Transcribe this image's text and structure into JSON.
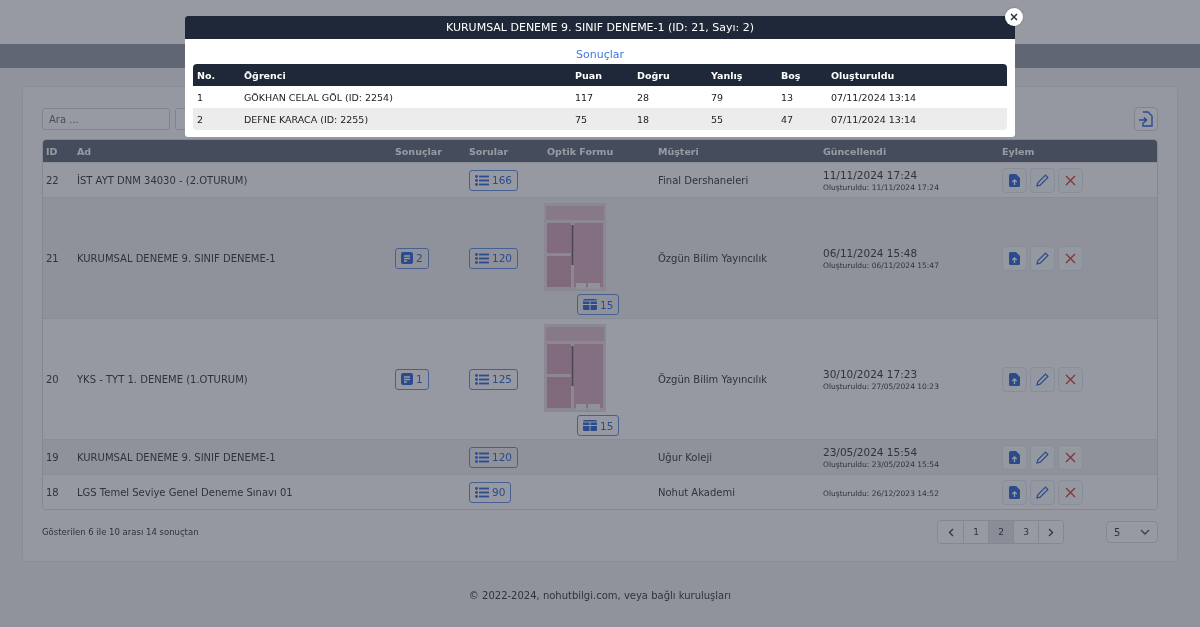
{
  "page": {
    "search": {
      "placeholder": "Ara ..."
    },
    "table": {
      "columns": [
        "ID",
        "Ad",
        "Sonuçlar",
        "Sorular",
        "Optik Formu",
        "Müşteri",
        "Güncellendi",
        "Eylem"
      ],
      "rows": [
        {
          "id": "22",
          "name": "İST AYT DNM 34030 - (2.OTURUM)",
          "results": null,
          "questions": "166",
          "optic": null,
          "customer": "Final Dershaneleri",
          "updated": "11/11/2024 17:24",
          "created": "Oluşturuldu: 11/11/2024 17:24"
        },
        {
          "id": "21",
          "name": "KURUMSAL DENEME 9. SINIF DENEME-1",
          "results": "2",
          "questions": "120",
          "optic": {
            "kind": "picture",
            "count": "15"
          },
          "customer": "Özgün Bilim Yayıncılık",
          "updated": "06/11/2024 15:48",
          "created": "Oluşturuldu: 06/11/2024 15:47"
        },
        {
          "id": "20",
          "name": "YKS - TYT 1. DENEME (1.OTURUM)",
          "results": "1",
          "questions": "125",
          "optic": {
            "kind": "picture",
            "count": "15"
          },
          "customer": "Özgün Bilim Yayıncılık",
          "updated": "30/10/2024 17:23",
          "created": "Oluşturuldu: 27/05/2024 10:23"
        },
        {
          "id": "19",
          "name": "KURUMSAL DENEME 9. SINIF DENEME-1",
          "results": null,
          "questions": "120",
          "optic": null,
          "customer": "Uğur Koleji",
          "updated": "23/05/2024 15:54",
          "created": "Oluşturuldu: 23/05/2024 15:54"
        },
        {
          "id": "18",
          "name": "LGS Temel Seviye Genel Deneme Sınavı 01",
          "results": null,
          "questions": "90",
          "optic": null,
          "customer": "Nohut Akademi",
          "updated": null,
          "created": "Oluşturuldu: 26/12/2023 14:52"
        }
      ]
    },
    "summary": "Gösterilen 6 ile 10 arası 14 sonuçtan",
    "pagination": {
      "pages": [
        {
          "label": "1",
          "selected": false
        },
        {
          "label": "2",
          "selected": true
        },
        {
          "label": "3",
          "selected": false
        }
      ]
    },
    "per_page": "5",
    "footer": "© 2022-2024, nohutbilgi.com, veya bağlı kuruluşları"
  },
  "modal": {
    "title": "KURUMSAL DENEME 9. SINIF DENEME-1 (ID: 21, Sayı: 2)",
    "section": "Sonuçlar",
    "columns": [
      "No.",
      "Öğrenci",
      "Puan",
      "Doğru",
      "Yanlış",
      "Boş",
      "Oluşturuldu"
    ],
    "rows": [
      [
        "1",
        "GÖKHAN CELAL GÖL (ID: 2254)",
        "117",
        "28",
        "79",
        "13",
        "07/11/2024 13:14"
      ],
      [
        "2",
        "DEFNE KARACA (ID: 2255)",
        "75",
        "18",
        "55",
        "47",
        "07/11/2024 13:14"
      ]
    ]
  }
}
